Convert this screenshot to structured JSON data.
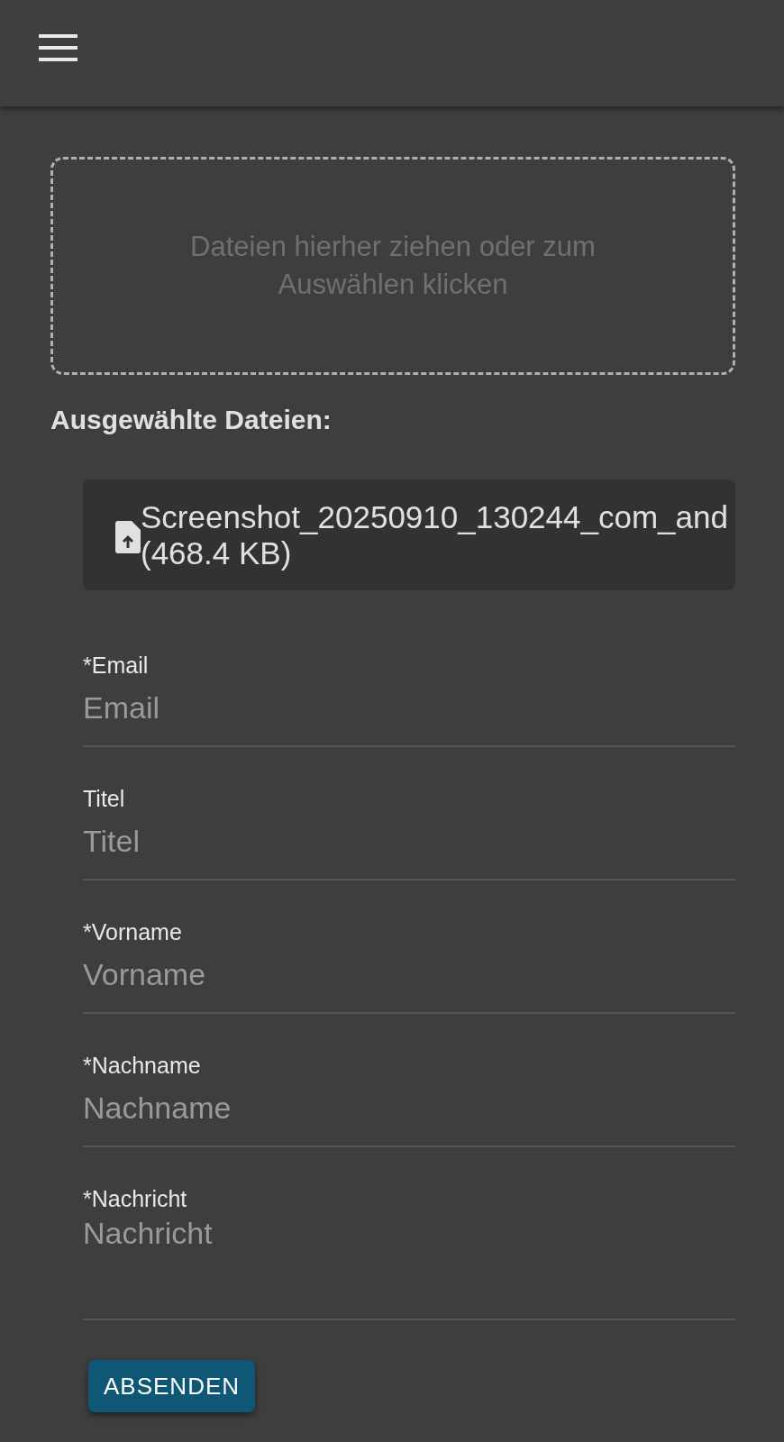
{
  "dropzone": {
    "text": "Dateien hierher ziehen oder zum Auswählen klicken"
  },
  "selected_files": {
    "heading": "Ausgewählte Dateien:",
    "files": [
      {
        "name": "Screenshot_20250910_130244_com_and",
        "size": "(468.4 KB)"
      }
    ]
  },
  "fields": [
    {
      "kind": "input",
      "label": "*Email",
      "placeholder": "Email"
    },
    {
      "kind": "input",
      "label": "Titel",
      "placeholder": "Titel"
    },
    {
      "kind": "input",
      "label": "*Vorname",
      "placeholder": "Vorname"
    },
    {
      "kind": "input",
      "label": "*Nachname",
      "placeholder": "Nachname"
    },
    {
      "kind": "textarea",
      "label": "*Nachricht",
      "placeholder": "Nachricht"
    }
  ],
  "submit": {
    "label": "ABSENDEN"
  }
}
